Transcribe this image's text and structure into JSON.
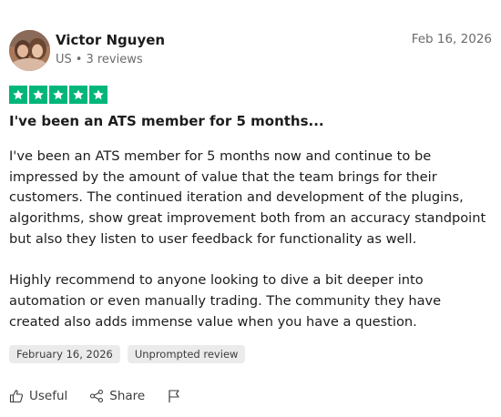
{
  "reviewer": {
    "name": "Victor Nguyen",
    "country": "US",
    "separator": "•",
    "reviews_count": "3 reviews"
  },
  "review": {
    "date": "Feb 16, 2026",
    "rating": 5,
    "title": "I've been an ATS member for 5 months...",
    "paragraphs": [
      "I've been an ATS member for 5 months now and continue to be impressed by the amount of value that the team brings for their customers. The continued iteration and development of the plugins, algorithms, show great improvement both from an accuracy standpoint but also they listen to user feedback for functionality as well.",
      "Highly recommend to anyone looking to dive a bit deeper into automation or even manually trading. The community they have created also adds immense value when you have a question."
    ],
    "tags": {
      "experience_date": "February 16, 2026",
      "review_type": "Unprompted review"
    }
  },
  "actions": {
    "useful_label": "Useful",
    "share_label": "Share",
    "flag_icon": "flag-icon",
    "useful_icon": "thumbs-up-icon",
    "share_icon": "share-icon"
  },
  "colors": {
    "star_green": "#00b67a",
    "tag_bg": "#ebebeb",
    "muted_text": "#6b6b6b"
  }
}
